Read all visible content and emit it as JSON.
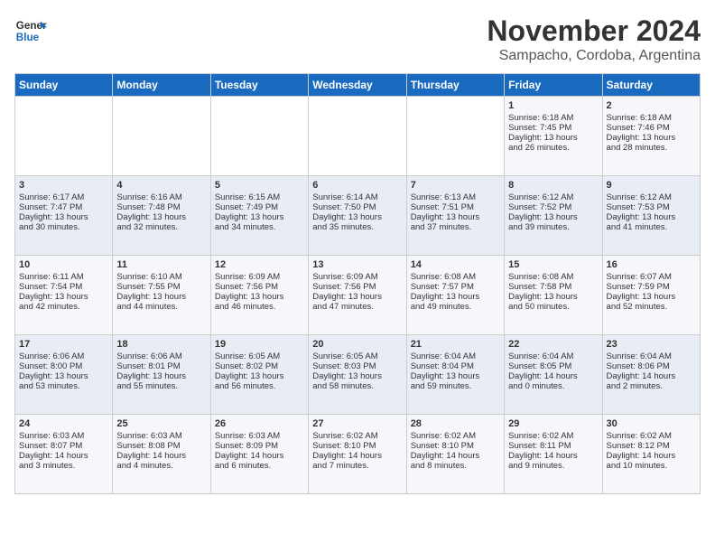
{
  "header": {
    "logo_line1": "General",
    "logo_line2": "Blue",
    "title": "November 2024",
    "subtitle": "Sampacho, Cordoba, Argentina"
  },
  "weekdays": [
    "Sunday",
    "Monday",
    "Tuesday",
    "Wednesday",
    "Thursday",
    "Friday",
    "Saturday"
  ],
  "weeks": [
    [
      {
        "day": "",
        "text": ""
      },
      {
        "day": "",
        "text": ""
      },
      {
        "day": "",
        "text": ""
      },
      {
        "day": "",
        "text": ""
      },
      {
        "day": "",
        "text": ""
      },
      {
        "day": "1",
        "text": "Sunrise: 6:18 AM\nSunset: 7:45 PM\nDaylight: 13 hours\nand 26 minutes."
      },
      {
        "day": "2",
        "text": "Sunrise: 6:18 AM\nSunset: 7:46 PM\nDaylight: 13 hours\nand 28 minutes."
      }
    ],
    [
      {
        "day": "3",
        "text": "Sunrise: 6:17 AM\nSunset: 7:47 PM\nDaylight: 13 hours\nand 30 minutes."
      },
      {
        "day": "4",
        "text": "Sunrise: 6:16 AM\nSunset: 7:48 PM\nDaylight: 13 hours\nand 32 minutes."
      },
      {
        "day": "5",
        "text": "Sunrise: 6:15 AM\nSunset: 7:49 PM\nDaylight: 13 hours\nand 34 minutes."
      },
      {
        "day": "6",
        "text": "Sunrise: 6:14 AM\nSunset: 7:50 PM\nDaylight: 13 hours\nand 35 minutes."
      },
      {
        "day": "7",
        "text": "Sunrise: 6:13 AM\nSunset: 7:51 PM\nDaylight: 13 hours\nand 37 minutes."
      },
      {
        "day": "8",
        "text": "Sunrise: 6:12 AM\nSunset: 7:52 PM\nDaylight: 13 hours\nand 39 minutes."
      },
      {
        "day": "9",
        "text": "Sunrise: 6:12 AM\nSunset: 7:53 PM\nDaylight: 13 hours\nand 41 minutes."
      }
    ],
    [
      {
        "day": "10",
        "text": "Sunrise: 6:11 AM\nSunset: 7:54 PM\nDaylight: 13 hours\nand 42 minutes."
      },
      {
        "day": "11",
        "text": "Sunrise: 6:10 AM\nSunset: 7:55 PM\nDaylight: 13 hours\nand 44 minutes."
      },
      {
        "day": "12",
        "text": "Sunrise: 6:09 AM\nSunset: 7:56 PM\nDaylight: 13 hours\nand 46 minutes."
      },
      {
        "day": "13",
        "text": "Sunrise: 6:09 AM\nSunset: 7:56 PM\nDaylight: 13 hours\nand 47 minutes."
      },
      {
        "day": "14",
        "text": "Sunrise: 6:08 AM\nSunset: 7:57 PM\nDaylight: 13 hours\nand 49 minutes."
      },
      {
        "day": "15",
        "text": "Sunrise: 6:08 AM\nSunset: 7:58 PM\nDaylight: 13 hours\nand 50 minutes."
      },
      {
        "day": "16",
        "text": "Sunrise: 6:07 AM\nSunset: 7:59 PM\nDaylight: 13 hours\nand 52 minutes."
      }
    ],
    [
      {
        "day": "17",
        "text": "Sunrise: 6:06 AM\nSunset: 8:00 PM\nDaylight: 13 hours\nand 53 minutes."
      },
      {
        "day": "18",
        "text": "Sunrise: 6:06 AM\nSunset: 8:01 PM\nDaylight: 13 hours\nand 55 minutes."
      },
      {
        "day": "19",
        "text": "Sunrise: 6:05 AM\nSunset: 8:02 PM\nDaylight: 13 hours\nand 56 minutes."
      },
      {
        "day": "20",
        "text": "Sunrise: 6:05 AM\nSunset: 8:03 PM\nDaylight: 13 hours\nand 58 minutes."
      },
      {
        "day": "21",
        "text": "Sunrise: 6:04 AM\nSunset: 8:04 PM\nDaylight: 13 hours\nand 59 minutes."
      },
      {
        "day": "22",
        "text": "Sunrise: 6:04 AM\nSunset: 8:05 PM\nDaylight: 14 hours\nand 0 minutes."
      },
      {
        "day": "23",
        "text": "Sunrise: 6:04 AM\nSunset: 8:06 PM\nDaylight: 14 hours\nand 2 minutes."
      }
    ],
    [
      {
        "day": "24",
        "text": "Sunrise: 6:03 AM\nSunset: 8:07 PM\nDaylight: 14 hours\nand 3 minutes."
      },
      {
        "day": "25",
        "text": "Sunrise: 6:03 AM\nSunset: 8:08 PM\nDaylight: 14 hours\nand 4 minutes."
      },
      {
        "day": "26",
        "text": "Sunrise: 6:03 AM\nSunset: 8:09 PM\nDaylight: 14 hours\nand 6 minutes."
      },
      {
        "day": "27",
        "text": "Sunrise: 6:02 AM\nSunset: 8:10 PM\nDaylight: 14 hours\nand 7 minutes."
      },
      {
        "day": "28",
        "text": "Sunrise: 6:02 AM\nSunset: 8:10 PM\nDaylight: 14 hours\nand 8 minutes."
      },
      {
        "day": "29",
        "text": "Sunrise: 6:02 AM\nSunset: 8:11 PM\nDaylight: 14 hours\nand 9 minutes."
      },
      {
        "day": "30",
        "text": "Sunrise: 6:02 AM\nSunset: 8:12 PM\nDaylight: 14 hours\nand 10 minutes."
      }
    ]
  ]
}
